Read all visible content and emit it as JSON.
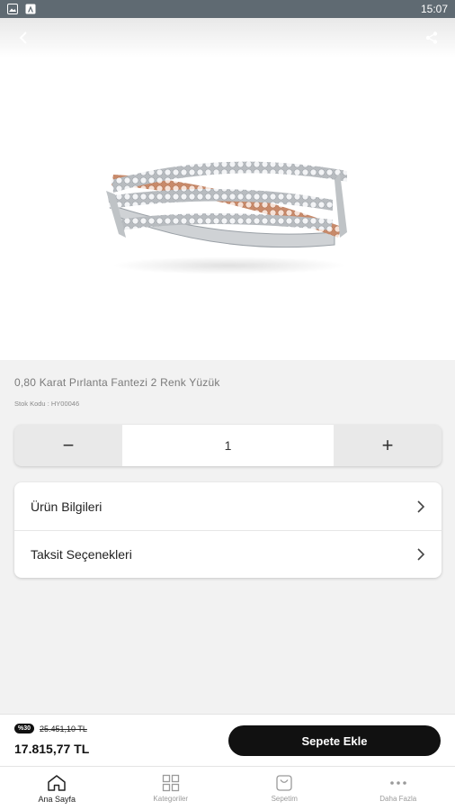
{
  "status_bar": {
    "time": "15:07"
  },
  "product": {
    "title": "0,80 Karat Pırlanta Fantezi 2 Renk Yüzük",
    "sku": "Stok Kodu : HY00046"
  },
  "quantity": {
    "minus": "−",
    "value": "1",
    "plus": "+"
  },
  "info_rows": [
    {
      "label": "Ürün Bilgileri"
    },
    {
      "label": "Taksit Seçenekleri"
    }
  ],
  "buy_bar": {
    "discount_badge": "%30",
    "old_price": "25.451,10 TL",
    "new_price": "17.815,77 TL",
    "add_to_cart": "Sepete Ekle"
  },
  "tabs": [
    {
      "label": "Ana Sayfa",
      "icon": "home-icon",
      "active": true
    },
    {
      "label": "Kategoriler",
      "icon": "grid-icon",
      "active": false
    },
    {
      "label": "Sepetim",
      "icon": "cart-icon",
      "active": false
    },
    {
      "label": "Daha Fazla",
      "icon": "more-icon",
      "active": false
    }
  ],
  "colors": {
    "primary": "#111111",
    "background": "#f2f2f2",
    "status_bar": "#5f6a72",
    "muted_text": "#7a7a7a"
  }
}
